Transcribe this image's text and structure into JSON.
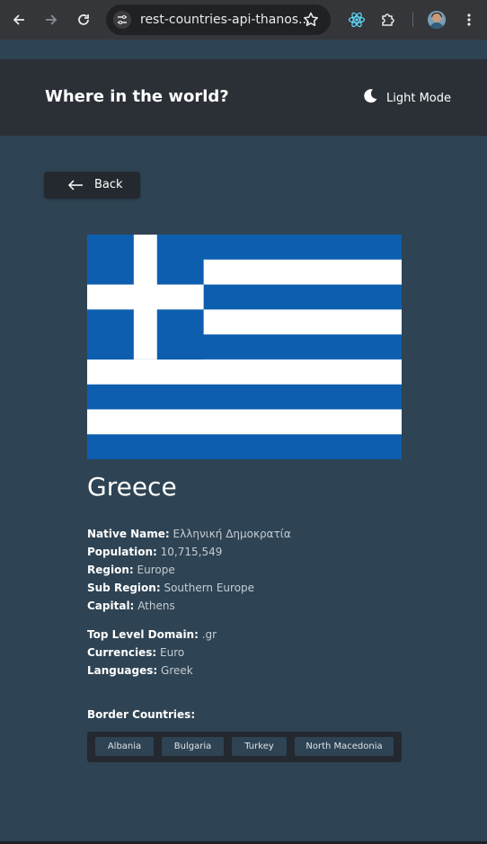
{
  "browser": {
    "url": "rest-countries-api-thanos...",
    "icons": [
      "back-icon",
      "forward-icon",
      "reload-icon",
      "site-info-icon",
      "bookmark-star-icon",
      "react-extension-icon",
      "extensions-puzzle-icon",
      "profile-avatar",
      "more-menu-icon"
    ]
  },
  "header": {
    "title": "Where in the world?",
    "mode_label": "Light Mode",
    "mode_icon": "moon-icon"
  },
  "back": {
    "label": "Back",
    "icon": "arrow-left-icon"
  },
  "country": {
    "flag": "greece-flag",
    "name": "Greece",
    "details_primary": [
      {
        "key": "Native Name:",
        "value": "Ελληνική Δημοκρατία"
      },
      {
        "key": "Population:",
        "value": "10,715,549"
      },
      {
        "key": "Region:",
        "value": "Europe"
      },
      {
        "key": "Sub Region:",
        "value": "Southern Europe"
      },
      {
        "key": "Capital:",
        "value": "Athens"
      }
    ],
    "details_secondary": [
      {
        "key": "Top Level Domain:",
        "value": ".gr"
      },
      {
        "key": "Currencies:",
        "value": "Euro"
      },
      {
        "key": "Languages:",
        "value": "Greek"
      }
    ],
    "border_title": "Border Countries:",
    "borders": [
      "Albania",
      "Bulgaria",
      "Turkey",
      "North Macedonia"
    ]
  },
  "colors": {
    "header_bg": "#2b3036",
    "page_bg": "#2e4353",
    "element_bg": "#23292f",
    "flag_blue": "#0d5eaf",
    "flag_white": "#ffffff"
  }
}
